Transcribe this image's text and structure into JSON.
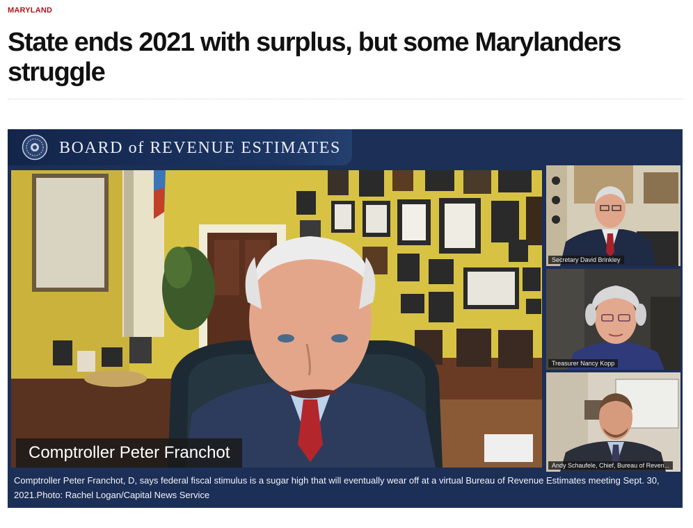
{
  "article": {
    "category": "MARYLAND",
    "headline": "State ends 2021 with surplus, but some Marylanders struggle"
  },
  "figure": {
    "banner_title": "BOARD of REVENUE ESTIMATES",
    "main_speaker_label": "Comptroller Peter Franchot",
    "participants": [
      {
        "label": "Secretary David Brinkley"
      },
      {
        "label": "Treasurer Nancy Kopp"
      },
      {
        "label": "Andy Schaufele, Chief, Bureau of Reven..."
      }
    ],
    "caption": "Comptroller Peter Franchot, D, says federal fiscal stimulus is a sugar high that will eventually wear off at a virtual Bureau of Revenue Estimates meeting Sept. 30, 2021.Photo: Rachel Logan/Capital News Service"
  },
  "colors": {
    "category_red": "#b0121a",
    "banner_navy": "#1c2f57",
    "wall_yellow": "#d9c34a"
  }
}
